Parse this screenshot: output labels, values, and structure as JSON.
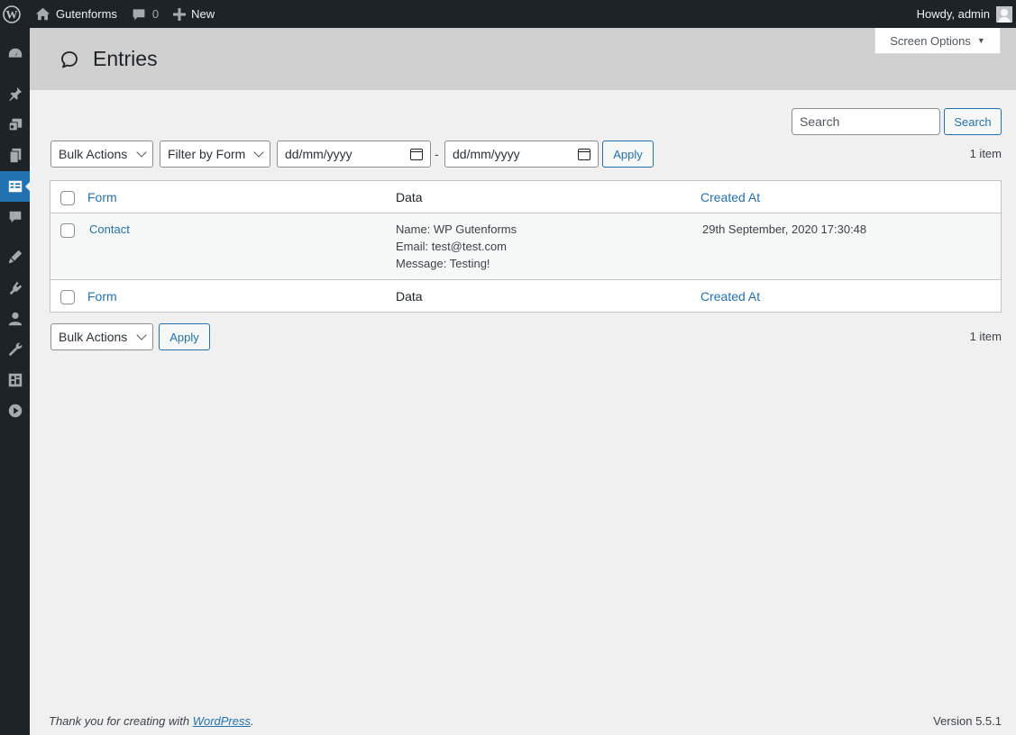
{
  "admin_bar": {
    "site_name": "Gutenforms",
    "comments_count": "0",
    "new_label": "New",
    "greeting": "Howdy, admin"
  },
  "sidebar": {
    "items": [
      {
        "icon": "dashboard-icon"
      },
      {
        "icon": "pin-icon"
      },
      {
        "icon": "media-icon"
      },
      {
        "icon": "pages-icon"
      },
      {
        "icon": "entries-icon",
        "current": true
      },
      {
        "icon": "comments-icon"
      },
      {
        "icon": "appearance-icon"
      },
      {
        "icon": "plugins-icon"
      },
      {
        "icon": "users-icon"
      },
      {
        "icon": "tools-icon"
      },
      {
        "icon": "settings-icon"
      },
      {
        "icon": "play-icon"
      }
    ]
  },
  "header": {
    "title": "Entries",
    "screen_options": "Screen Options"
  },
  "search": {
    "placeholder": "Search",
    "button": "Search"
  },
  "filters": {
    "bulk_actions": "Bulk Actions",
    "filter_by_form": "Filter by Form",
    "date_from": "dd/mm/yyyy",
    "date_separator": "-",
    "date_to": "dd/mm/yyyy",
    "apply": "Apply",
    "items_count": "1 item"
  },
  "table": {
    "columns": [
      "Form",
      "Data",
      "Created At"
    ],
    "rows": [
      {
        "form": "Contact",
        "data": [
          "Name: WP Gutenforms",
          "Email: test@test.com",
          "Message: Testing!"
        ],
        "created_at": "29th September, 2020 17:30:48"
      }
    ]
  },
  "bottom_actions": {
    "bulk_actions": "Bulk Actions",
    "apply": "Apply",
    "items_count": "1 item"
  },
  "footer": {
    "thanks_prefix": "Thank you for creating with ",
    "thanks_link": "WordPress",
    "thanks_suffix": ".",
    "version": "Version 5.5.1"
  },
  "colors": {
    "admin_bar_bg": "#1d2327",
    "accent": "#2271b1",
    "page_bg": "#f0f0f1",
    "header_bg": "#d0d0d0"
  }
}
